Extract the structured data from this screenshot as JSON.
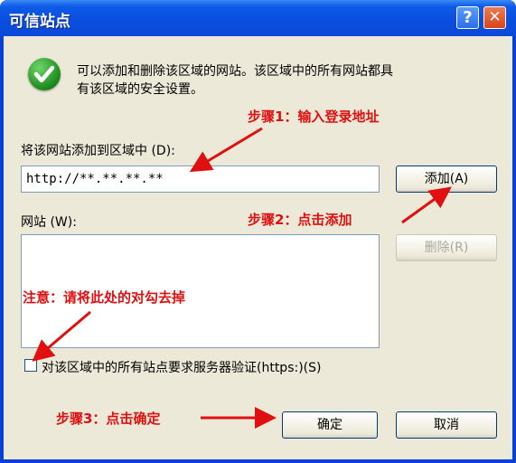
{
  "window": {
    "title": "可信站点",
    "help_label": "?",
    "close_label": "✕"
  },
  "info": {
    "icon": "checkmark-icon",
    "line1": "可以添加和删除该区域的网站。该区域中的所有网站都具",
    "line2": "有该区域的安全设置。"
  },
  "add_field": {
    "label": "将该网站添加到区域中 (D):",
    "value": "http://**.**.**.**"
  },
  "add_button": {
    "label": "添加(A)"
  },
  "sites": {
    "label": "网站 (W):",
    "items": []
  },
  "remove_button": {
    "label": "删除(R)"
  },
  "https_checkbox": {
    "label": "对该区域中的所有站点要求服务器验证(https:)(S)",
    "checked": false
  },
  "ok_button": {
    "label": "确定"
  },
  "cancel_button": {
    "label": "取消"
  },
  "annotations": {
    "step1": "步骤1：输入登录地址",
    "step2": "步骤2：点击添加",
    "step3": "步骤3：点击确定",
    "note": "注意：请将此处的对勾去掉"
  },
  "colors": {
    "title_bar": "#0a4ee0",
    "client": "#ece9d8",
    "annotation": "#e01010"
  }
}
